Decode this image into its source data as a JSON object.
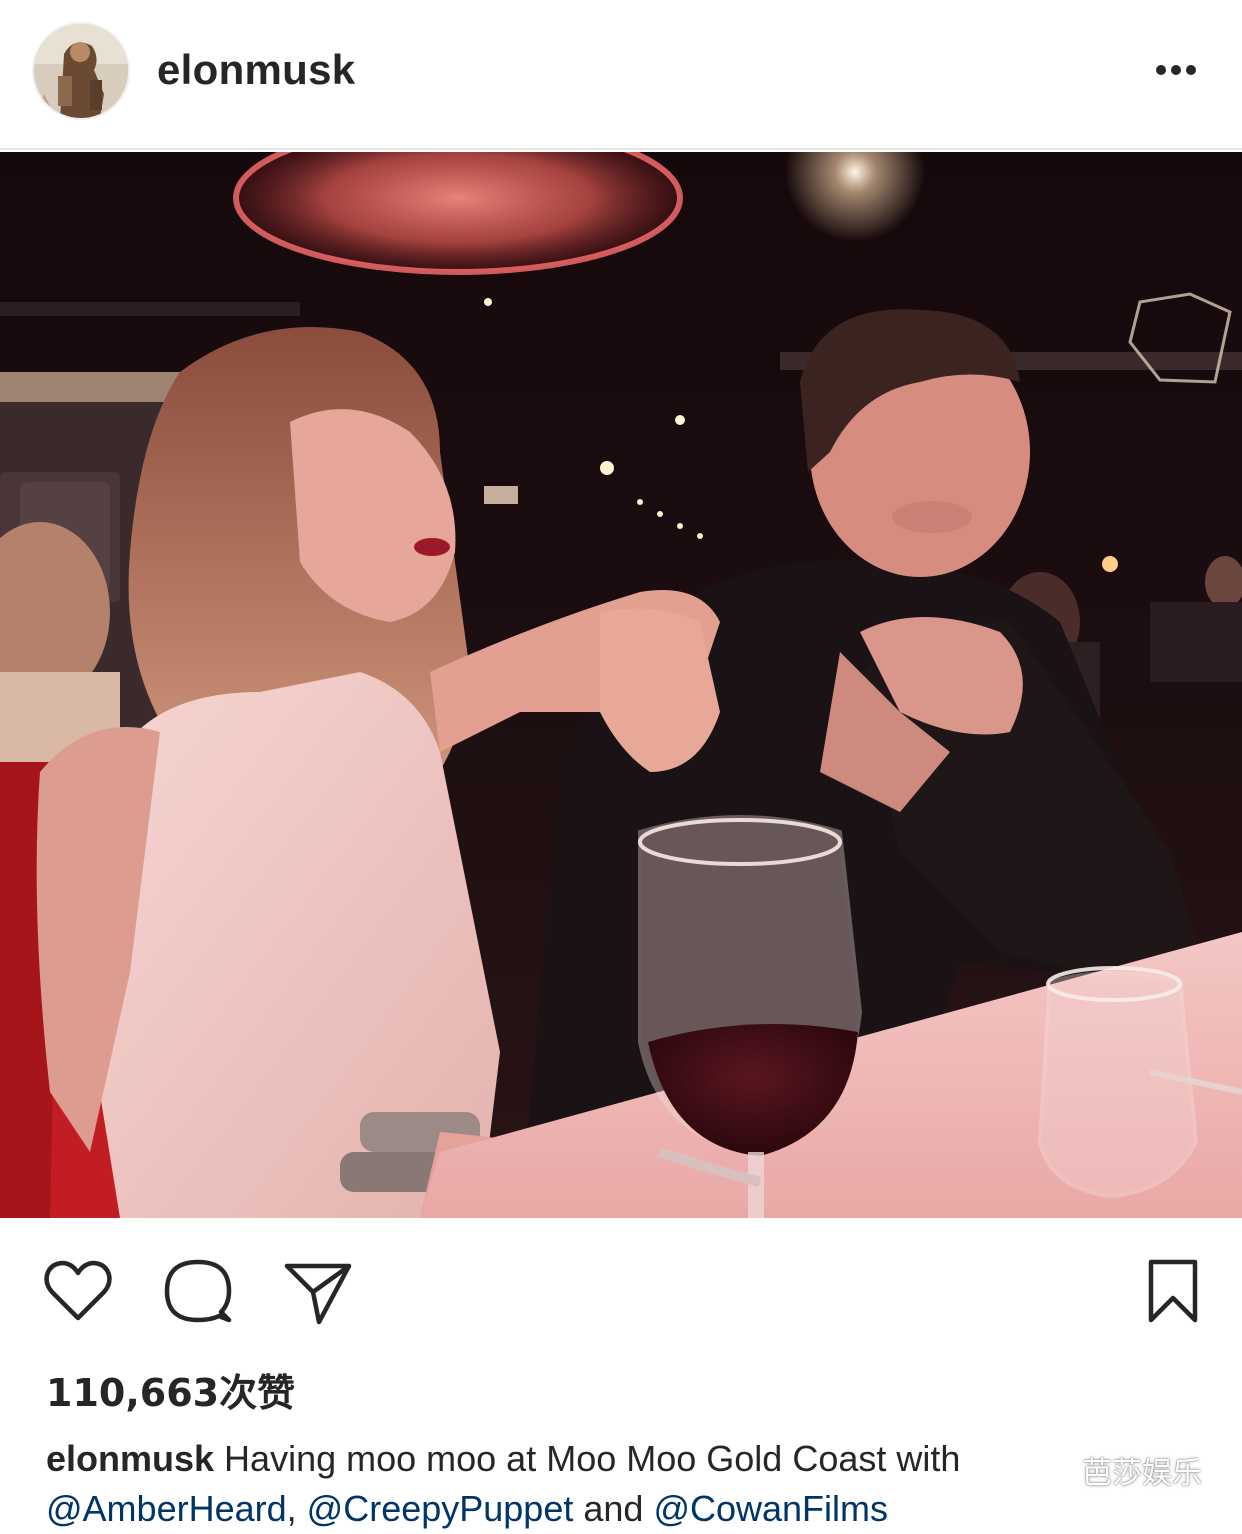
{
  "header": {
    "username": "elonmusk",
    "more_icon": "more-horizontal-icon"
  },
  "photo": {
    "subject": "two people seated at a restaurant table with wine glasses under a red pendant lamp"
  },
  "actions": {
    "icons": [
      "heart-icon",
      "comment-icon",
      "share-icon",
      "bookmark-icon"
    ]
  },
  "likes": {
    "count": "110,663",
    "suffix": "次赞"
  },
  "caption": {
    "username": "elonmusk",
    "text": " Having moo moo at Moo Moo Gold Coast with ",
    "mention_1": "@AmberHeard",
    "sep_1": ", ",
    "mention_2": "@CreepyPuppet",
    "sep_2": " and ",
    "mention_3": "@CowanFilms"
  },
  "watermark": {
    "text": "芭莎娱乐"
  },
  "colors": {
    "text": "#262626",
    "mention": "#003569",
    "divider": "#e6e6e6"
  }
}
